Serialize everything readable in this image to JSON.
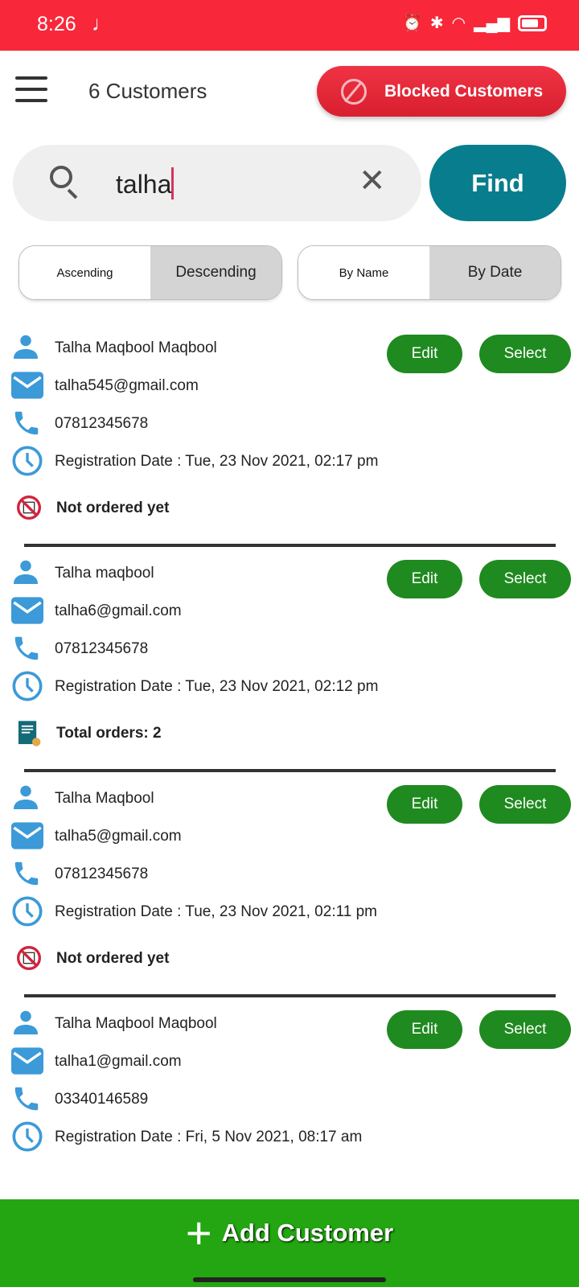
{
  "status_bar": {
    "time": "8:26"
  },
  "header": {
    "count": "6 Customers",
    "blocked_label": "Blocked Customers"
  },
  "search": {
    "value": "talha",
    "find_label": "Find"
  },
  "sort": {
    "order": [
      "Ascending",
      "Descending"
    ],
    "order_selected": "Descending",
    "by": [
      "By Name",
      "By Date"
    ],
    "by_selected": "By Date"
  },
  "labels": {
    "edit": "Edit",
    "select": "Select"
  },
  "customers": [
    {
      "name": "Talha Maqbool Maqbool",
      "email": "talha545@gmail.com",
      "phone": "07812345678",
      "registration": "Registration Date : Tue, 23 Nov 2021, 02:17 pm",
      "orders": "Not ordered yet",
      "ordered": false
    },
    {
      "name": "Talha maqbool",
      "email": "talha6@gmail.com",
      "phone": "07812345678",
      "registration": "Registration Date : Tue, 23 Nov 2021, 02:12 pm",
      "orders": "Total orders: 2",
      "ordered": true
    },
    {
      "name": "Talha Maqbool",
      "email": "talha5@gmail.com",
      "phone": "07812345678",
      "registration": "Registration Date : Tue, 23 Nov 2021, 02:11 pm",
      "orders": "Not ordered yet",
      "ordered": false
    },
    {
      "name": "Talha Maqbool Maqbool",
      "email": "talha1@gmail.com",
      "phone": "03340146589",
      "registration": "Registration Date : Fri, 5 Nov 2021, 08:17 am"
    }
  ],
  "footer": {
    "add_label": "Add Customer"
  },
  "colors": {
    "status": "#f8283a",
    "find": "#087d8d",
    "button": "#1f8a1f",
    "footer": "#23a611",
    "icon": "#3c9ad8"
  }
}
